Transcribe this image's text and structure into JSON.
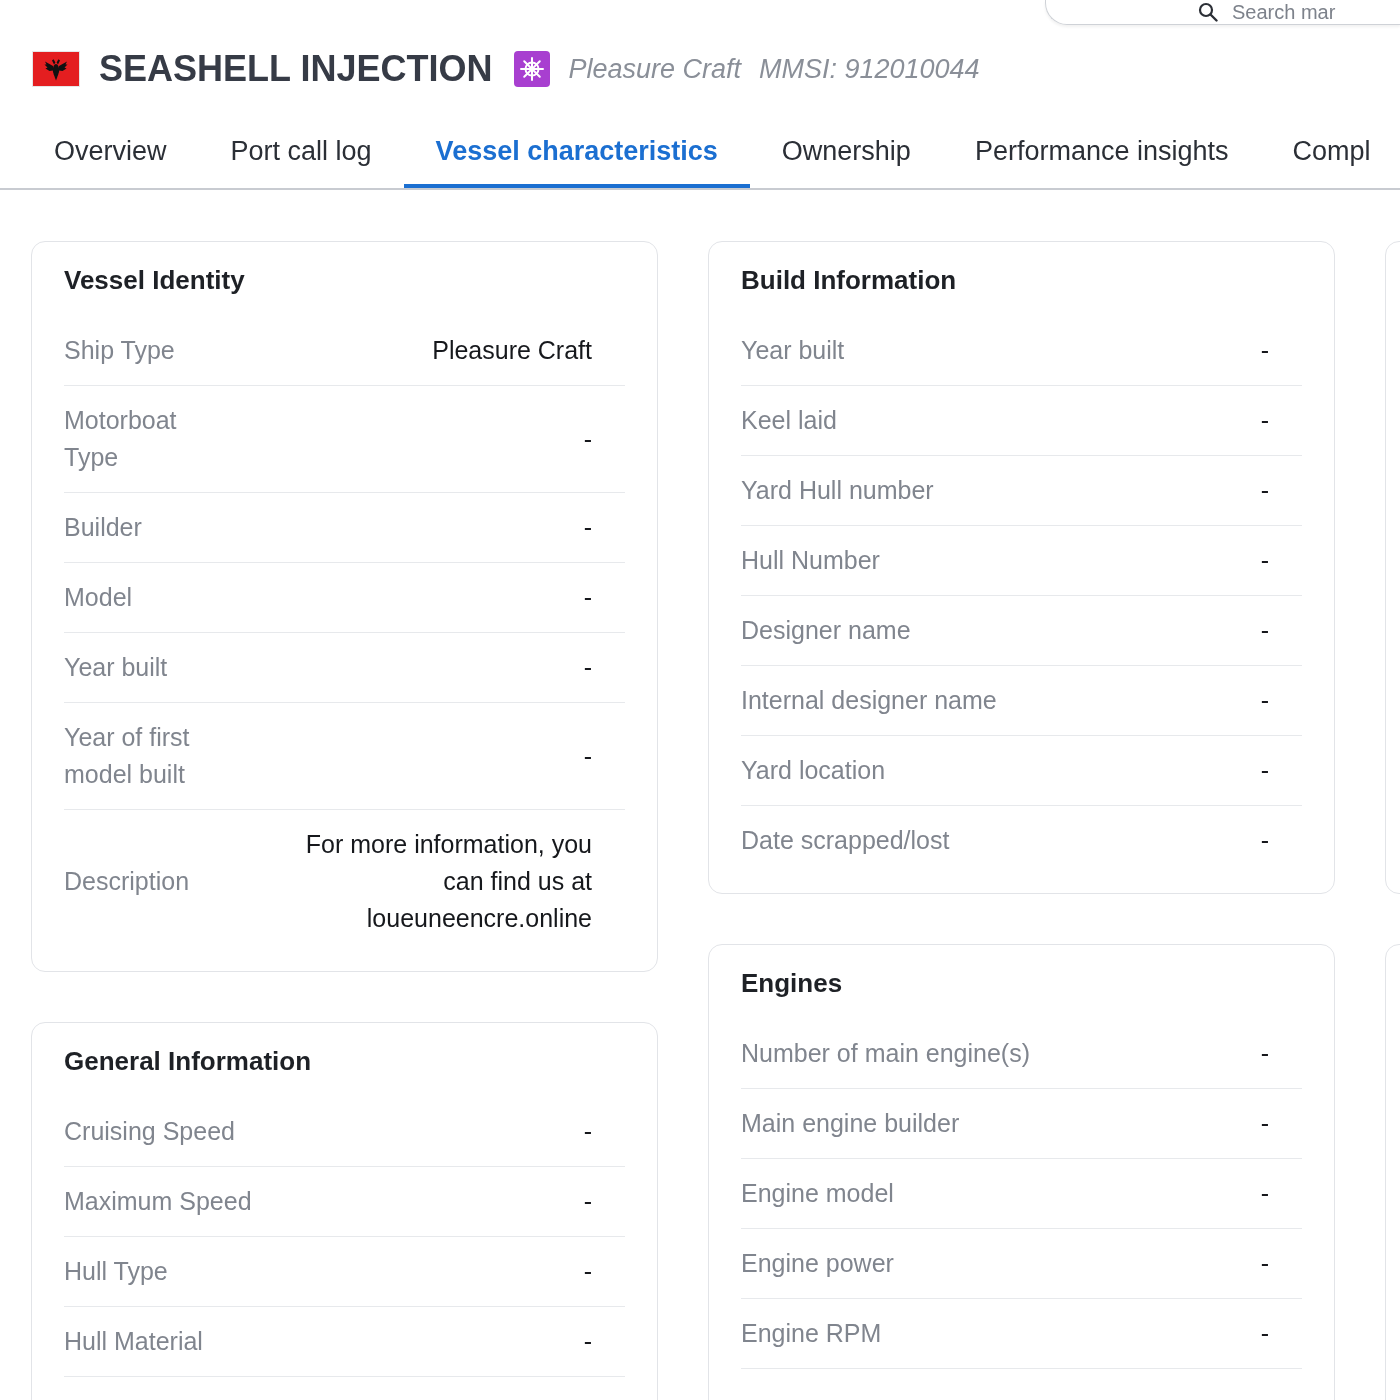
{
  "search": {
    "placeholder": "Search mar"
  },
  "vessel": {
    "name": "SEASHELL INJECTION",
    "type": "Pleasure Craft",
    "mmsi": "MMSI: 912010044"
  },
  "tabs": [
    {
      "label": "Overview",
      "selected": false
    },
    {
      "label": "Port call log",
      "selected": false
    },
    {
      "label": "Vessel characteristics",
      "selected": true
    },
    {
      "label": "Ownership",
      "selected": false
    },
    {
      "label": "Performance insights",
      "selected": false
    },
    {
      "label": "Compl",
      "selected": false
    }
  ],
  "columns": [
    {
      "cards": [
        {
          "title": "Vessel Identity",
          "continues_below": false,
          "rows": [
            {
              "label": "Ship Type",
              "value": "Pleasure Craft"
            },
            {
              "label": "Motorboat Type",
              "value": "-"
            },
            {
              "label": "Builder",
              "value": "-"
            },
            {
              "label": "Model",
              "value": "-"
            },
            {
              "label": "Year built",
              "value": "-"
            },
            {
              "label": "Year of first model built",
              "value": "-"
            },
            {
              "label": "Description",
              "value": "For more information, you can find us at loueuneencre.online"
            }
          ]
        },
        {
          "title": "General Information",
          "continues_below": true,
          "rows": [
            {
              "label": "Cruising Speed",
              "value": "-"
            },
            {
              "label": "Maximum Speed",
              "value": "-"
            },
            {
              "label": "Hull Type",
              "value": "-"
            },
            {
              "label": "Hull Material",
              "value": "-"
            }
          ]
        }
      ]
    },
    {
      "cards": [
        {
          "title": "Build Information",
          "continues_below": false,
          "rows": [
            {
              "label": "Year built",
              "value": "-"
            },
            {
              "label": "Keel laid",
              "value": "-"
            },
            {
              "label": "Yard Hull number",
              "value": "-"
            },
            {
              "label": "Hull Number",
              "value": "-"
            },
            {
              "label": "Designer name",
              "value": "-"
            },
            {
              "label": "Internal designer name",
              "value": "-"
            },
            {
              "label": "Yard location",
              "value": "-"
            },
            {
              "label": "Date scrapped/lost",
              "value": "-"
            }
          ]
        },
        {
          "title": "Engines",
          "continues_below": true,
          "rows": [
            {
              "label": "Number of main engine(s)",
              "value": "-"
            },
            {
              "label": "Main engine builder",
              "value": "-"
            },
            {
              "label": "Engine model",
              "value": "-"
            },
            {
              "label": "Engine power",
              "value": "-"
            },
            {
              "label": "Engine RPM",
              "value": "-"
            }
          ]
        }
      ]
    }
  ]
}
